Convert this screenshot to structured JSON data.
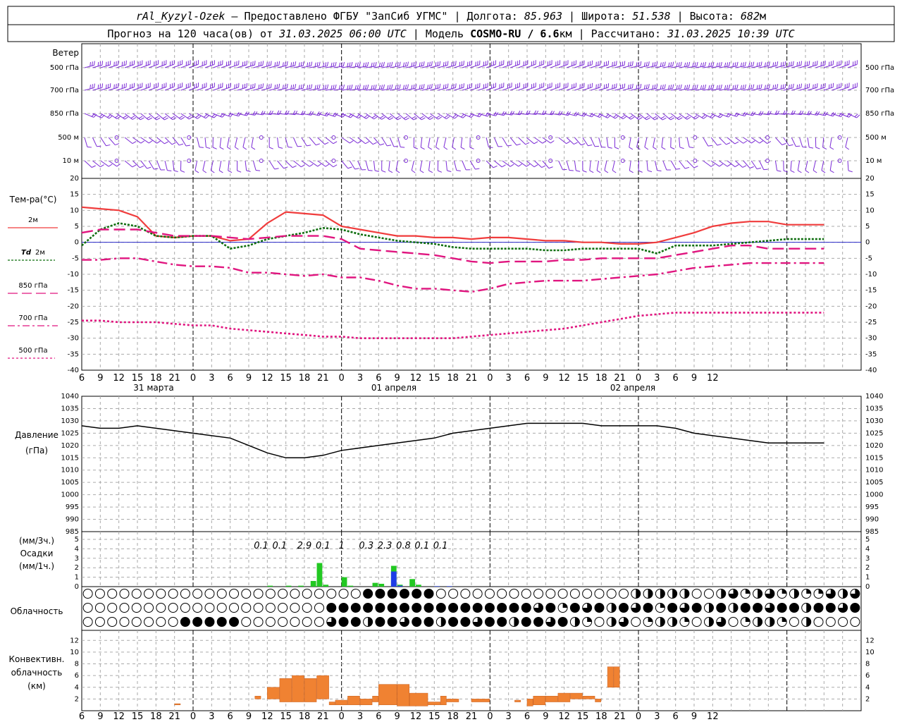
{
  "header": {
    "station": "rAl_Kyzyl-Ozek",
    "provider": " — Предоставлено ФГБУ \"ЗапСиб УГМС\" | Долгота: ",
    "lon": "85.963",
    "lat_label": " | Широта: ",
    "lat": "51.538",
    "alt_label": " | Высота: ",
    "alt": "682",
    "alt_unit": "м",
    "line2_a": "Прогноз на 120 часа(ов) от ",
    "run_time": "31.03.2025 06:00 UTC",
    "line2_b": " | Модель ",
    "model": "COSMO-RU / 6.6",
    "model_unit": "км",
    "line2_c": " | Рассчитано: ",
    "calc_time": "31.03.2025 10:39 UTC"
  },
  "labels": {
    "wind": "Ветер",
    "wind_levels": [
      "500 гПа",
      "700 гПа",
      "850 гПа",
      "500 м",
      "10  м"
    ],
    "temp": "Тем-ра(°C)",
    "t2m": "2м",
    "td": "Td",
    "td_level": "2м",
    "t850": "850 гПа",
    "t700": "700 гПа",
    "t500": "500 гПа",
    "pressure": "Давление",
    "pressure_unit": "(гПа)",
    "precip_unit3": "(мм/3ч.)",
    "precip": "Осадки",
    "precip_unit1": "(мм/1ч.)",
    "cloud": "Облачность",
    "conv1": "Конвективн.",
    "conv2": "облачность",
    "conv3": "(км)",
    "dates": [
      "31 марта",
      "01 апреля",
      "02 апреля"
    ]
  },
  "colors": {
    "wind": "#7b2bd6",
    "t2m": "#f03c3c",
    "td": "#0f6e0f",
    "t850": "#e0157f",
    "t700": "#e0157f",
    "t500": "#e0157f",
    "zero_line": "#2828c8",
    "precip_rain": "#22c822",
    "precip_snow": "#1e3ce6",
    "conv": "#f08232"
  },
  "chart_data": [
    {
      "type": "line",
      "title": "Тем-ра(°C)",
      "x_hours_from_start": [
        0,
        3,
        6,
        9,
        12,
        15,
        18,
        21,
        24,
        27,
        30,
        33,
        36,
        39,
        42,
        45,
        48,
        51,
        54,
        57,
        60,
        63,
        66,
        69,
        72,
        75,
        78,
        81,
        84,
        87,
        90,
        93,
        96,
        99,
        102,
        105,
        108,
        111,
        114,
        117,
        120
      ],
      "xticks": [
        "6",
        "9",
        "12",
        "15",
        "18",
        "21",
        "0",
        "3",
        "6",
        "9",
        "12",
        "15",
        "18",
        "21",
        "0",
        "3",
        "6",
        "9",
        "12",
        "15",
        "18",
        "21",
        "0",
        "3",
        "6",
        "9",
        "12",
        "15",
        "18",
        "21",
        "0",
        "3",
        "6",
        "9",
        "12"
      ],
      "ylim": [
        -40,
        20
      ],
      "yticks": [
        20,
        15,
        10,
        5,
        0,
        -5,
        -10,
        -15,
        -20,
        -25,
        -30,
        -35,
        -40
      ],
      "series": [
        {
          "name": "2м",
          "values": [
            11,
            10.5,
            10,
            8,
            2,
            1.5,
            2,
            2,
            0.5,
            1,
            6,
            9.5,
            9,
            8.5,
            5,
            4,
            3,
            2,
            2,
            1.5,
            1.5,
            1,
            1.5,
            1.5,
            1,
            0.5,
            0.5,
            0,
            0,
            -0.5,
            -0.5,
            0,
            1.5,
            3,
            5,
            6,
            6.5,
            6.5,
            5.5,
            5.5,
            5.5
          ]
        },
        {
          "name": "Td 2м",
          "values": [
            -1,
            4,
            6,
            5,
            2,
            1.5,
            2,
            2,
            -2,
            -1,
            1,
            2,
            3,
            4.5,
            4,
            2.5,
            1.5,
            0.5,
            0,
            -0.5,
            -1.5,
            -2,
            -2,
            -2,
            -2,
            -2.5,
            -2.5,
            -2,
            -2,
            -2,
            -2,
            -3.5,
            -1,
            -1,
            -1,
            -0.5,
            0,
            0.5,
            1,
            1,
            1
          ]
        },
        {
          "name": "850 гПа",
          "values": [
            3,
            4,
            4,
            4,
            3,
            2,
            2,
            2,
            1.5,
            1,
            1.5,
            2,
            2,
            2,
            1,
            -2,
            -2.5,
            -3,
            -3.5,
            -4,
            -5,
            -6,
            -6.5,
            -6,
            -6,
            -6,
            -5.5,
            -5.5,
            -5,
            -5,
            -5,
            -5,
            -4,
            -3,
            -2,
            -1,
            -1,
            -2,
            -2,
            -2,
            -2
          ]
        },
        {
          "name": "700 гПа",
          "values": [
            -5.5,
            -5.5,
            -5,
            -5,
            -6,
            -7,
            -7.5,
            -7.5,
            -8,
            -9.5,
            -9.5,
            -10,
            -10.5,
            -10,
            -11,
            -11,
            -12,
            -13.5,
            -14.5,
            -14.5,
            -15,
            -15.5,
            -14.5,
            -13,
            -12.5,
            -12,
            -12,
            -12,
            -11.5,
            -11,
            -10.5,
            -10,
            -9,
            -8,
            -7.5,
            -7,
            -6.5,
            -6.5,
            -6.5,
            -6.5,
            -6.5
          ]
        },
        {
          "name": "500 гПа",
          "values": [
            -24.5,
            -24.5,
            -25,
            -25,
            -25,
            -25.5,
            -26,
            -26,
            -27,
            -27.5,
            -28,
            -28.5,
            -29,
            -29.5,
            -29.5,
            -30,
            -30,
            -30,
            -30,
            -30,
            -30,
            -29.5,
            -29,
            -28.5,
            -28,
            -27.5,
            -27,
            -26,
            -25,
            -24,
            -23,
            -22.5,
            -22,
            -22,
            -22,
            -22,
            -22,
            -22,
            -22,
            -22,
            -22
          ]
        }
      ]
    },
    {
      "type": "line",
      "title": "Давление",
      "ylabel": "(гПа)",
      "ylim": [
        985,
        1040
      ],
      "yticks": [
        1040,
        1035,
        1030,
        1025,
        1020,
        1015,
        1010,
        1005,
        1000,
        995,
        990,
        985
      ],
      "x_hours_from_start": [
        0,
        3,
        6,
        9,
        12,
        15,
        18,
        21,
        24,
        27,
        30,
        33,
        36,
        39,
        42,
        45,
        48,
        51,
        54,
        57,
        60,
        63,
        66,
        69,
        72,
        75,
        78,
        81,
        84,
        87,
        90,
        93,
        96,
        99,
        102,
        105,
        108,
        111,
        114,
        117,
        120
      ],
      "series": [
        {
          "name": "Давление",
          "values": [
            1028,
            1027,
            1027,
            1028,
            1027,
            1026,
            1025,
            1024,
            1023,
            1020,
            1017,
            1015,
            1015,
            1016,
            1018,
            1019,
            1020,
            1021,
            1022,
            1023,
            1025,
            1026,
            1027,
            1028,
            1029,
            1029,
            1029,
            1029,
            1028,
            1028,
            1028,
            1028,
            1027,
            1025,
            1024,
            1023,
            1022,
            1021,
            1021,
            1021,
            1021
          ]
        }
      ]
    },
    {
      "type": "bar",
      "title": "Осадки",
      "ylim": [
        0,
        5
      ],
      "yticks": [
        5,
        4,
        3,
        2,
        1,
        0
      ],
      "sums_3h": [
        "0.1",
        "0.1",
        "2.9",
        "0.1",
        "1",
        "0.3",
        "2.3",
        "0.8",
        "0.1",
        "0.1"
      ],
      "hourly_rain": [
        [
          30,
          0.1
        ],
        [
          33,
          0.1
        ],
        [
          35,
          0.1
        ],
        [
          37,
          0.6
        ],
        [
          38,
          2.5
        ],
        [
          39,
          0.2
        ],
        [
          42,
          1.0
        ],
        [
          43,
          0.1
        ],
        [
          47,
          0.4
        ],
        [
          48,
          0.3
        ],
        [
          50,
          2.2
        ],
        [
          51,
          0.2
        ],
        [
          53,
          0.8
        ],
        [
          54,
          0.2
        ]
      ],
      "hourly_snow": [
        [
          50,
          1.6
        ],
        [
          51,
          0.1
        ],
        [
          57,
          0.05
        ],
        [
          59,
          0.05
        ]
      ]
    },
    {
      "type": "bar",
      "title": "Конвективн. облачность",
      "ylabel": "(км)",
      "ylim": [
        0,
        13
      ],
      "yticks": [
        12,
        10,
        8,
        6,
        4,
        2
      ],
      "segments_km": [
        [
          15,
          16,
          1.0,
          1.2
        ],
        [
          28,
          29,
          2.0,
          2.5
        ],
        [
          30,
          32,
          2.0,
          4.0
        ],
        [
          32,
          34,
          1.5,
          5.5
        ],
        [
          34,
          36,
          1.5,
          6.0
        ],
        [
          36,
          38,
          1.5,
          5.5
        ],
        [
          38,
          40,
          2.0,
          6.0
        ],
        [
          40,
          41,
          1.0,
          1.5
        ],
        [
          41,
          43,
          1.0,
          1.8
        ],
        [
          43,
          45,
          1.0,
          2.5
        ],
        [
          45,
          47,
          1.0,
          2.0
        ],
        [
          47,
          48,
          1.5,
          2.5
        ],
        [
          48,
          51,
          1.0,
          4.5
        ],
        [
          51,
          53,
          0.8,
          4.5
        ],
        [
          53,
          56,
          0.8,
          3.0
        ],
        [
          56,
          58,
          1.0,
          1.5
        ],
        [
          58,
          59,
          1.0,
          2.5
        ],
        [
          59,
          61,
          1.5,
          2.0
        ],
        [
          63,
          66,
          1.5,
          2.0
        ],
        [
          70,
          71,
          1.5,
          1.8
        ],
        [
          72,
          73,
          0.8,
          2.0
        ],
        [
          73,
          75,
          1.0,
          2.5
        ],
        [
          75,
          77,
          1.5,
          2.5
        ],
        [
          77,
          79,
          1.5,
          3.0
        ],
        [
          79,
          81,
          2.0,
          3.0
        ],
        [
          81,
          83,
          2.0,
          2.5
        ],
        [
          83,
          84,
          1.5,
          2.0
        ],
        [
          85,
          86,
          4.0,
          7.5
        ],
        [
          86,
          87,
          4.0,
          7.5
        ]
      ]
    }
  ]
}
